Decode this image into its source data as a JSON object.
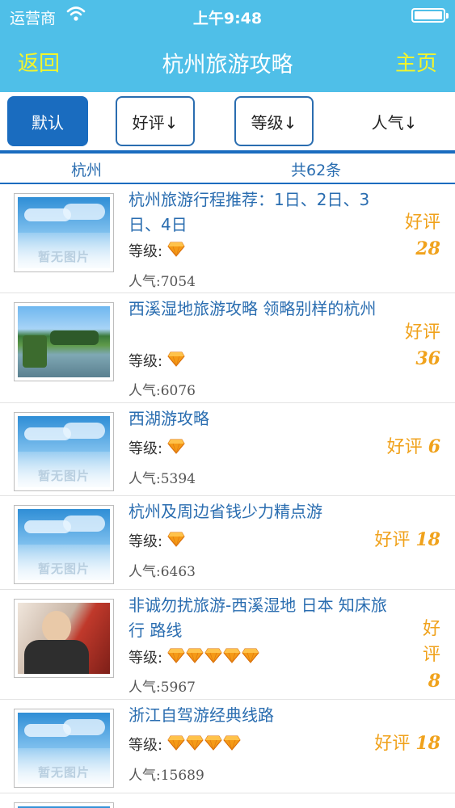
{
  "status_bar": {
    "carrier": "运营商",
    "time": "上午9:48"
  },
  "nav": {
    "back": "返回",
    "title": "杭州旅游攻略",
    "home": "主页"
  },
  "sort": [
    "默认",
    "好评↓",
    "等级↓",
    "人气↓"
  ],
  "summary": {
    "city": "杭州",
    "count": "共62条"
  },
  "rating_label": "好评",
  "level_label": "等级:",
  "items": [
    {
      "title": "杭州旅游行程推荐：1日、2日、3日、4日",
      "gems": 1,
      "popularity": "人气:7054",
      "score": "28",
      "thumb": "placeholder",
      "thumb_text": "暂无图片"
    },
    {
      "title": "西溪湿地旅游攻略 领略别样的杭州",
      "gems": 1,
      "popularity": "人气:6076",
      "score": "36",
      "thumb": "lake-photo"
    },
    {
      "title": "西湖游攻略",
      "gems": 1,
      "popularity": "人气:5394",
      "score": "6",
      "thumb": "placeholder",
      "thumb_text": "暂无图片"
    },
    {
      "title": "杭州及周边省钱少力精点游",
      "gems": 1,
      "popularity": "人气:6463",
      "score": "18",
      "thumb": "placeholder",
      "thumb_text": "暂无图片"
    },
    {
      "title": "非诚勿扰旅游-西溪湿地 日本 知床旅行 路线",
      "gems": 5,
      "popularity": "人气:5967",
      "score": "8",
      "thumb": "person-photo"
    },
    {
      "title": "浙江自驾游经典线路",
      "gems": 4,
      "popularity": "人气:15689",
      "score": "18",
      "thumb": "placeholder",
      "thumb_text": "暂无图片"
    }
  ],
  "colors": {
    "nav_bg": "#4fbfe8",
    "nav_button": "#f3f52b",
    "accent": "#1a6cbf",
    "title_text": "#2a6db0",
    "rating": "#f0a21c"
  }
}
